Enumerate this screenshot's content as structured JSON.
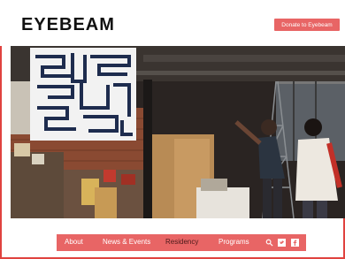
{
  "header": {
    "logo": "EYEBEAM",
    "donate_label": "Donate to Eyebeam"
  },
  "nav": {
    "items": [
      {
        "label": "About",
        "active": false
      },
      {
        "label": "News & Events",
        "active": false
      },
      {
        "label": "Residency",
        "active": true
      },
      {
        "label": "Programs",
        "active": false
      }
    ],
    "icons": [
      "search-icon",
      "twitter-icon",
      "facebook-icon"
    ]
  },
  "colors": {
    "accent": "#e86565",
    "border": "#e0433f",
    "logo": "#111111"
  }
}
